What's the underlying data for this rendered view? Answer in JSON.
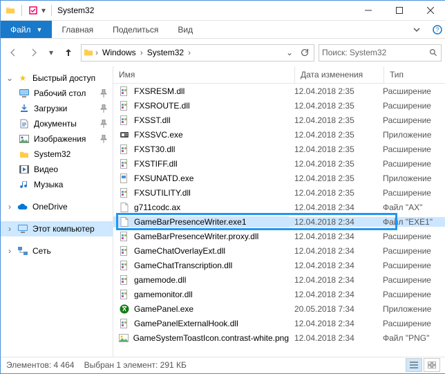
{
  "window": {
    "title": "System32"
  },
  "ribbon": {
    "file": "Файл",
    "tabs": [
      "Главная",
      "Поделиться",
      "Вид"
    ]
  },
  "breadcrumb": [
    "Windows",
    "System32"
  ],
  "search": {
    "placeholder": "Поиск: System32"
  },
  "sidebar": {
    "quick": {
      "label": "Быстрый доступ",
      "items": [
        {
          "label": "Рабочий стол",
          "pin": true,
          "icon": "desktop"
        },
        {
          "label": "Загрузки",
          "pin": true,
          "icon": "downloads"
        },
        {
          "label": "Документы",
          "pin": true,
          "icon": "documents"
        },
        {
          "label": "Изображения",
          "pin": true,
          "icon": "pictures"
        },
        {
          "label": "System32",
          "pin": false,
          "icon": "folder"
        },
        {
          "label": "Видео",
          "pin": false,
          "icon": "video"
        },
        {
          "label": "Музыка",
          "pin": false,
          "icon": "music"
        }
      ]
    },
    "onedrive": "OneDrive",
    "thispc": "Этот компьютер",
    "network": "Сеть"
  },
  "columns": {
    "name": "Имя",
    "date": "Дата изменения",
    "type": "Тип"
  },
  "files": [
    {
      "name": "FXSRESM.dll",
      "date": "12.04.2018 2:35",
      "type": "Расширение",
      "icon": "dll"
    },
    {
      "name": "FXSROUTE.dll",
      "date": "12.04.2018 2:35",
      "type": "Расширение",
      "icon": "dll"
    },
    {
      "name": "FXSST.dll",
      "date": "12.04.2018 2:35",
      "type": "Расширение",
      "icon": "dll"
    },
    {
      "name": "FXSSVC.exe",
      "date": "12.04.2018 2:35",
      "type": "Приложение",
      "icon": "exe-fax"
    },
    {
      "name": "FXST30.dll",
      "date": "12.04.2018 2:35",
      "type": "Расширение",
      "icon": "dll"
    },
    {
      "name": "FXSTIFF.dll",
      "date": "12.04.2018 2:35",
      "type": "Расширение",
      "icon": "dll"
    },
    {
      "name": "FXSUNATD.exe",
      "date": "12.04.2018 2:35",
      "type": "Приложение",
      "icon": "exe"
    },
    {
      "name": "FXSUTILITY.dll",
      "date": "12.04.2018 2:35",
      "type": "Расширение",
      "icon": "dll"
    },
    {
      "name": "g711codc.ax",
      "date": "12.04.2018 2:34",
      "type": "Файл \"AX\"",
      "icon": "file"
    },
    {
      "name": "GameBarPresenceWriter.exe1",
      "date": "12.04.2018 2:34",
      "type": "Файл \"EXE1\"",
      "icon": "file",
      "highlight": true
    },
    {
      "name": "GameBarPresenceWriter.proxy.dll",
      "date": "12.04.2018 2:34",
      "type": "Расширение",
      "icon": "dll"
    },
    {
      "name": "GameChatOverlayExt.dll",
      "date": "12.04.2018 2:34",
      "type": "Расширение",
      "icon": "dll"
    },
    {
      "name": "GameChatTranscription.dll",
      "date": "12.04.2018 2:34",
      "type": "Расширение",
      "icon": "dll"
    },
    {
      "name": "gamemode.dll",
      "date": "12.04.2018 2:34",
      "type": "Расширение",
      "icon": "dll"
    },
    {
      "name": "gamemonitor.dll",
      "date": "12.04.2018 2:34",
      "type": "Расширение",
      "icon": "dll"
    },
    {
      "name": "GamePanel.exe",
      "date": "20.05.2018 7:34",
      "type": "Приложение",
      "icon": "xbox"
    },
    {
      "name": "GamePanelExternalHook.dll",
      "date": "12.04.2018 2:34",
      "type": "Расширение",
      "icon": "dll"
    },
    {
      "name": "GameSystemToastIcon.contrast-white.png",
      "date": "12.04.2018 2:34",
      "type": "Файл \"PNG\"",
      "icon": "png"
    }
  ],
  "status": {
    "count_label": "Элементов:",
    "count": "4 464",
    "sel_label": "Выбран 1 элемент:",
    "sel_size": "291 КБ"
  }
}
